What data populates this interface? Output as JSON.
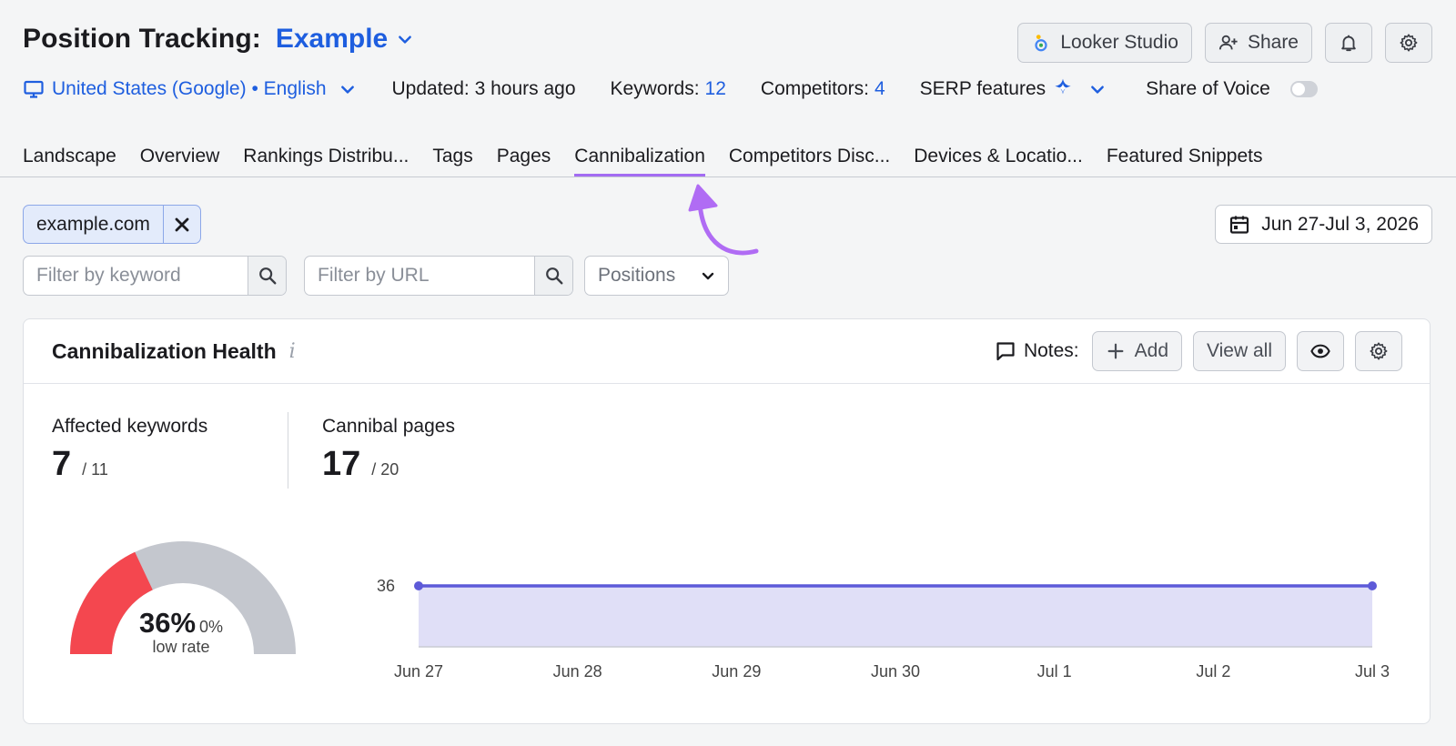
{
  "header": {
    "title": "Position Tracking:",
    "project": "Example",
    "buttons": {
      "looker": "Looker Studio",
      "share": "Share"
    }
  },
  "meta": {
    "location": "United States (Google) • English",
    "updated": "Updated: 3 hours ago",
    "keywords_label": "Keywords:",
    "keywords_value": "12",
    "competitors_label": "Competitors:",
    "competitors_value": "4",
    "serp_label": "SERP features",
    "share_of_voice": "Share of Voice",
    "share_of_voice_on": false
  },
  "tabs": [
    {
      "label": "Landscape",
      "active": false
    },
    {
      "label": "Overview",
      "active": false
    },
    {
      "label": "Rankings Distribu...",
      "active": false
    },
    {
      "label": "Tags",
      "active": false
    },
    {
      "label": "Pages",
      "active": false
    },
    {
      "label": "Cannibalization",
      "active": true
    },
    {
      "label": "Competitors Disc...",
      "active": false
    },
    {
      "label": "Devices & Locatio...",
      "active": false
    },
    {
      "label": "Featured Snippets",
      "active": false
    }
  ],
  "filters": {
    "domain_chip": "example.com",
    "date_range": "Jun 27-Jul 3, 2026",
    "keyword_placeholder": "Filter by keyword",
    "url_placeholder": "Filter by URL",
    "positions": "Positions"
  },
  "card": {
    "title": "Cannibalization Health",
    "info": "i",
    "notes_label": "Notes:",
    "add": "Add",
    "view_all": "View all",
    "affected_label": "Affected keywords",
    "affected_value": "7",
    "affected_total": "/ 11",
    "pages_label": "Cannibal pages",
    "pages_value": "17",
    "pages_total": "/ 20",
    "gauge": {
      "pct": "36%",
      "delta": "0%",
      "sub": "low rate",
      "value": 0.36
    }
  },
  "colors": {
    "accent": "#1e5edf",
    "tab_active": "#a36cf2",
    "gauge_filled": "#f4474f",
    "gauge_empty": "#c4c7ce",
    "series": "#5d5ad8",
    "area": "#e0dff7"
  },
  "chart_data": {
    "type": "area",
    "categories": [
      "Jun 27",
      "Jun 28",
      "Jun 29",
      "Jun 30",
      "Jul 1",
      "Jul 2",
      "Jul 3"
    ],
    "y_tick": "36",
    "series": [
      {
        "values": [
          36,
          36,
          36,
          36,
          36,
          36,
          36
        ]
      }
    ]
  }
}
